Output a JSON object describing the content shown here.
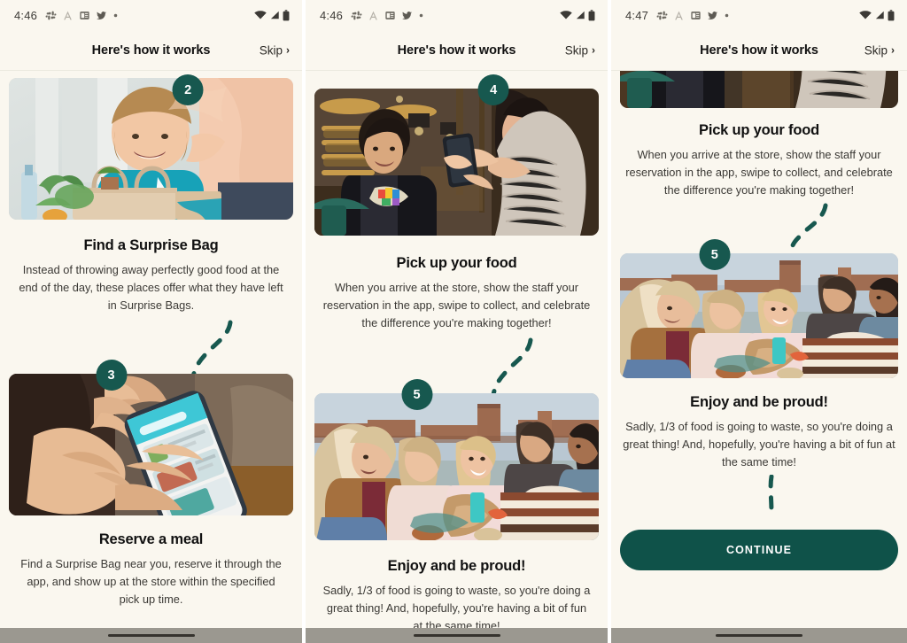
{
  "app": {
    "background_color": "#faf7ef",
    "accent_color": "#17584f",
    "cta_color": "#0f5249",
    "header_title": "Here's how it works",
    "skip_label": "Skip",
    "skip_chevron": "›"
  },
  "screens": [
    {
      "status": {
        "time": "4:46",
        "icons": [
          "slack-icon",
          "font-icon",
          "news-icon",
          "twitter-icon",
          "dot-icon"
        ],
        "right_icons": [
          "wifi-icon",
          "signal-icon",
          "battery-icon"
        ]
      },
      "header": {
        "title": "Here's how it works",
        "skip": "Skip"
      },
      "steps": [
        {
          "badge": "2",
          "badge_align": "center",
          "photo": "kid-receiving-grocery-bag-photo",
          "title": "Find a Surprise Bag",
          "body": "Instead of throwing away perfectly good food at the end of the day, these places offer what they have left in Surprise Bags."
        },
        {
          "badge": "3",
          "badge_align": "left",
          "photo": "hands-holding-phone-app-photo",
          "title": "Reserve a meal",
          "body": "Find a Surprise Bag near you, reserve it through the app, and show up at the store within the specified pick up time."
        }
      ]
    },
    {
      "status": {
        "time": "4:46",
        "icons": [
          "slack-icon",
          "font-icon",
          "news-icon",
          "twitter-icon",
          "dot-icon"
        ],
        "right_icons": [
          "wifi-icon",
          "signal-icon",
          "battery-icon"
        ]
      },
      "header": {
        "title": "Here's how it works",
        "skip": "Skip"
      },
      "steps": [
        {
          "badge": "4",
          "badge_align": "center",
          "photo": "customer-showing-phone-to-staff-photo",
          "title": "Pick up your food",
          "body": "When you arrive at the store, show the staff your reservation in the app, swipe to collect, and celebrate the difference you're making together!"
        },
        {
          "badge": "5",
          "badge_align": "left",
          "photo": "friends-sharing-food-rooftop-photo",
          "title": "Enjoy and be proud!",
          "body": "Sadly, 1/3 of food is going to waste, so you're doing a great thing! And, hopefully, you're having a bit of fun at the same time!"
        }
      ]
    },
    {
      "status": {
        "time": "4:47",
        "icons": [
          "slack-icon",
          "font-icon",
          "news-icon",
          "twitter-icon",
          "dot-icon"
        ],
        "right_icons": [
          "wifi-icon",
          "signal-icon",
          "battery-icon"
        ]
      },
      "header": {
        "title": "Here's how it works",
        "skip": "Skip"
      },
      "steps": [
        {
          "badge": "",
          "badge_align": "center",
          "photo": "customer-showing-phone-to-staff-photo",
          "title": "Pick up your food",
          "body": "When you arrive at the store, show the staff your reservation in the app, swipe to collect, and celebrate the difference you're making together!"
        },
        {
          "badge": "5",
          "badge_align": "center",
          "photo": "friends-sharing-food-rooftop-photo",
          "title": "Enjoy and be proud!",
          "body": "Sadly, 1/3 of food is going to waste, so you're doing a great thing! And, hopefully, you're having a bit of fun at the same time!"
        }
      ],
      "cta_label": "CONTINUE"
    }
  ]
}
